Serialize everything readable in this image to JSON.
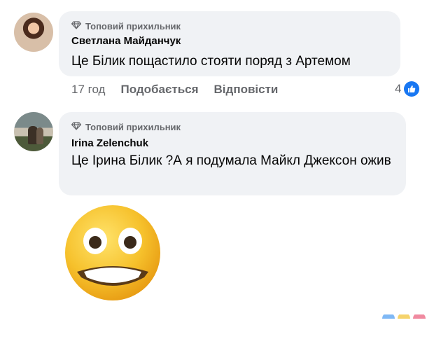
{
  "comments": [
    {
      "badge": "Топовий прихильник",
      "author": "Светлана Майданчук",
      "text": "Це Білик пощастило стояти поряд з Артемом",
      "time": "17 год",
      "like_label": "Подобається",
      "reply_label": "Відповісти",
      "reaction_count": "4"
    },
    {
      "badge": "Топовий прихильник",
      "author": "Irina Zelenchuk",
      "text": "Це Ірина Білик ?А я подумала Майкл Джексон ожив"
    }
  ],
  "colors": {
    "bubble_bg": "#f0f2f5",
    "meta_text": "#65676b",
    "like_blue": "#1877f2",
    "emoji_yellow": "#f6c12c"
  },
  "icons": [
    "diamond-icon",
    "like-reaction-icon",
    "grimacing-emoji"
  ]
}
